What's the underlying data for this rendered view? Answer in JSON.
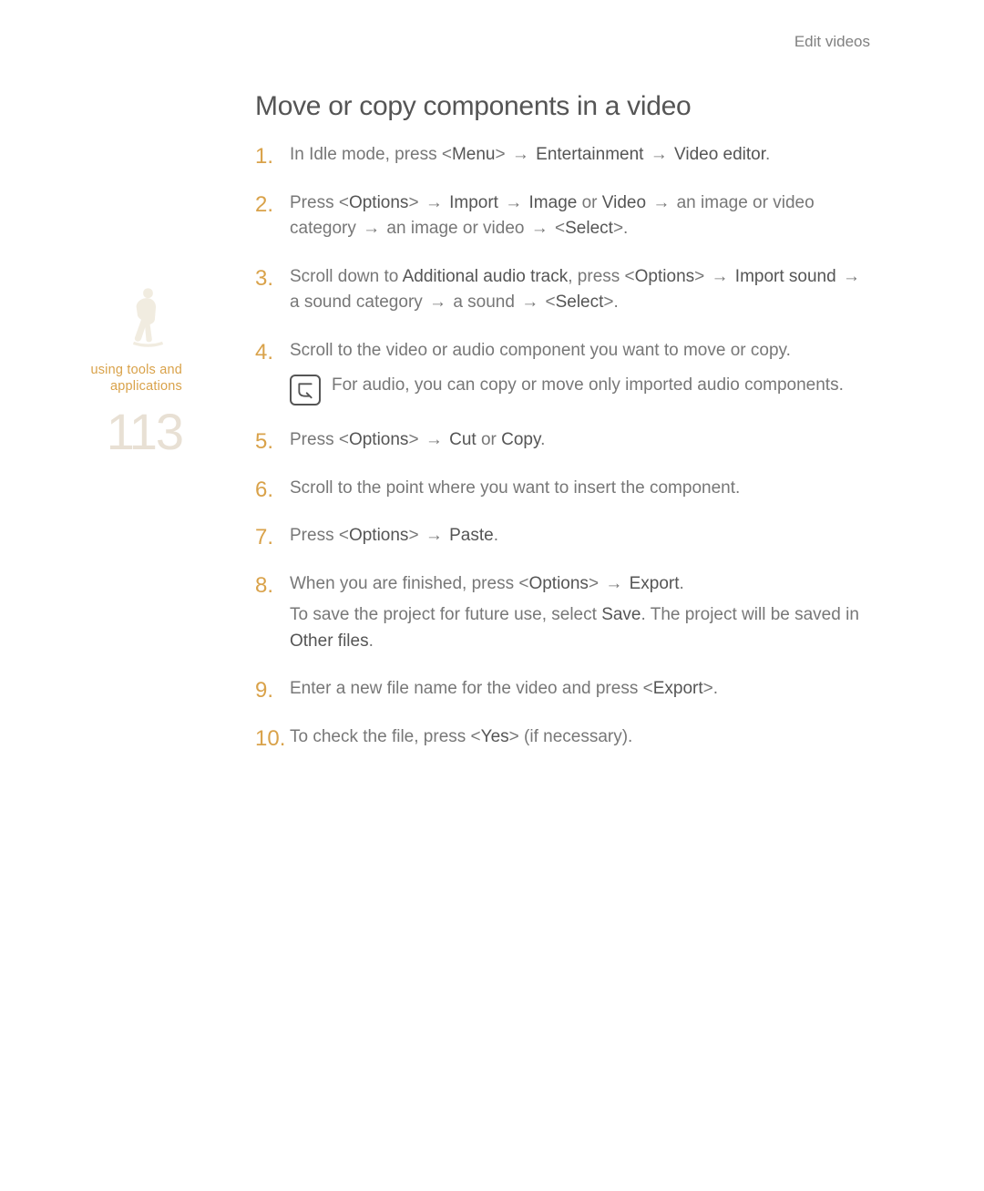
{
  "header": {
    "section": "Edit videos"
  },
  "sidebar": {
    "caption_line1": "using tools and",
    "caption_line2": "applications",
    "page_number": "113"
  },
  "main": {
    "title": "Move or copy components in a video",
    "steps": {
      "s1": {
        "t1": "In Idle mode, press <",
        "k1": "Menu",
        "t2": "> ",
        "arr1": "→",
        "t3": " ",
        "k2": "Entertainment",
        "t4": " ",
        "arr2": "→",
        "t5": " ",
        "k3": "Video editor",
        "t6": "."
      },
      "s2": {
        "t1": "Press <",
        "k1": "Options",
        "t2": "> ",
        "arr1": "→",
        "t3": " ",
        "k2": "Import",
        "t4": " ",
        "arr2": "→",
        "t5": " ",
        "k3": "Image",
        "t6": " or ",
        "k4": "Video",
        "t7": " ",
        "arr3": "→",
        "t8": " an image or video category ",
        "arr4": "→",
        "t9": " an image or video ",
        "arr5": "→",
        "t10": " <",
        "k5": "Select",
        "t11": ">."
      },
      "s3": {
        "t1": "Scroll down to ",
        "k1": "Additional audio track",
        "t2": ", press <",
        "k2": "Options",
        "t3": "> ",
        "arr1": "→",
        "t4": " ",
        "k3": "Import sound",
        "t5": " ",
        "arr2": "→",
        "t6": " a sound category ",
        "arr3": "→",
        "t7": " a sound ",
        "arr4": "→",
        "t8": " <",
        "k4": "Select",
        "t9": ">."
      },
      "s4": {
        "t1": "Scroll to the video or audio component you want to move or copy.",
        "note": "For audio, you can copy or move only imported audio components."
      },
      "s5": {
        "t1": "Press <",
        "k1": "Options",
        "t2": "> ",
        "arr1": "→",
        "t3": " ",
        "k2": "Cut",
        "t4": " or ",
        "k3": "Copy",
        "t5": "."
      },
      "s6": {
        "t1": "Scroll to the point where you want to insert the component."
      },
      "s7": {
        "t1": "Press <",
        "k1": "Options",
        "t2": "> ",
        "arr1": "→",
        "t3": " ",
        "k2": "Paste",
        "t4": "."
      },
      "s8": {
        "t1": "When you are finished, press <",
        "k1": "Options",
        "t2": "> ",
        "arr1": "→",
        "t3": " ",
        "k2": "Export",
        "t4": ".",
        "sub1": "To save the project for future use, select ",
        "ks1": "Save",
        "sub2": ". The project will be saved in ",
        "ks2": "Other files",
        "sub3": "."
      },
      "s9": {
        "t1": "Enter a new file name for the video and press <",
        "k1": "Export",
        "t2": ">."
      },
      "s10": {
        "t1": "To check the file, press <",
        "k1": "Yes",
        "t2": "> (if necessary)."
      }
    }
  }
}
